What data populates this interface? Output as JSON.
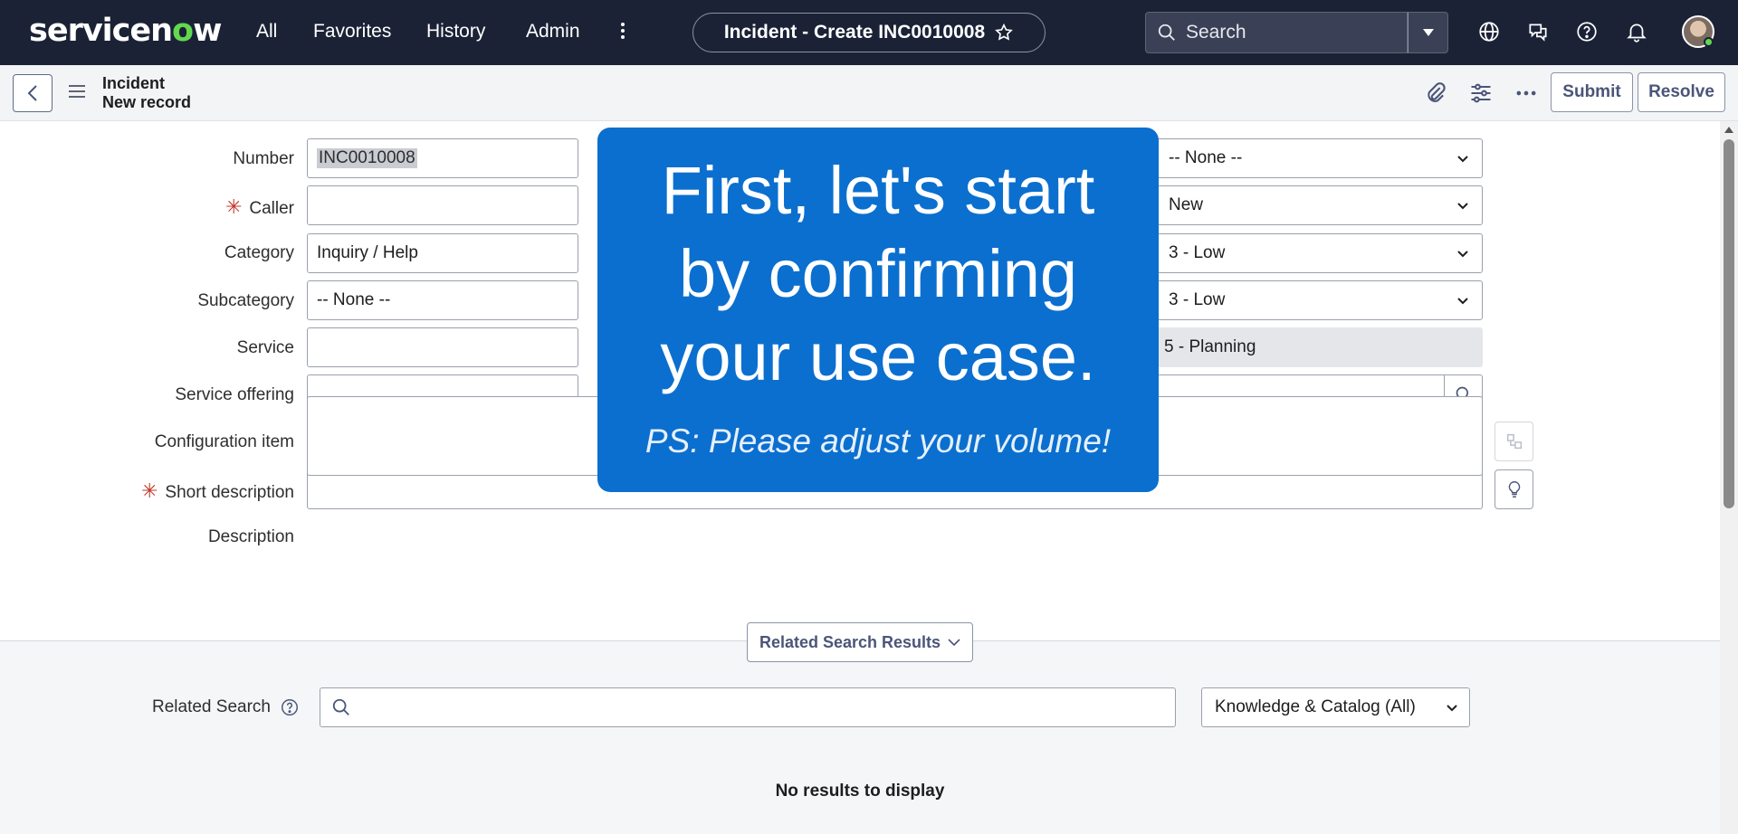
{
  "topnav": {
    "logo_pre": "servicen",
    "logo_o": "o",
    "logo_post": "w",
    "links": [
      "All",
      "Favorites",
      "History",
      "Admin"
    ],
    "record_title": "Incident - Create INC0010008",
    "search_placeholder": "Search"
  },
  "record_header": {
    "table": "Incident",
    "subtitle": "New record",
    "submit_label": "Submit",
    "resolve_label": "Resolve"
  },
  "form": {
    "left": [
      {
        "label": "Number",
        "value": "INC0010008",
        "required": false
      },
      {
        "label": "Caller",
        "value": "",
        "required": true
      },
      {
        "label": "Category",
        "value": "Inquiry / Help",
        "required": false
      },
      {
        "label": "Subcategory",
        "value": "-- None --",
        "required": false
      },
      {
        "label": "Service",
        "value": "",
        "required": false
      },
      {
        "label": "Service offering",
        "value": "",
        "required": false
      },
      {
        "label": "Configuration item",
        "value": "",
        "required": false
      }
    ],
    "right": [
      {
        "value": "-- None --"
      },
      {
        "value": "New"
      },
      {
        "value": "3 - Low"
      },
      {
        "value": "3 - Low"
      },
      {
        "value": "5 - Planning"
      }
    ],
    "short_description_label": "Short description",
    "description_label": "Description"
  },
  "overlay": {
    "line1": "First, let's start",
    "line2": "by confirming",
    "line3": "your use case.",
    "sub": "PS: Please adjust your volume!",
    "color": "#0b6fcf"
  },
  "related": {
    "tab_label": "Related Search Results",
    "search_label": "Related Search",
    "source_select": "Knowledge & Catalog (All)",
    "empty_message": "No results to display"
  },
  "colors": {
    "nav_bg": "#1b2236",
    "brand_green": "#62d84e",
    "required": "#c0392b",
    "button_text": "#4a5578"
  }
}
